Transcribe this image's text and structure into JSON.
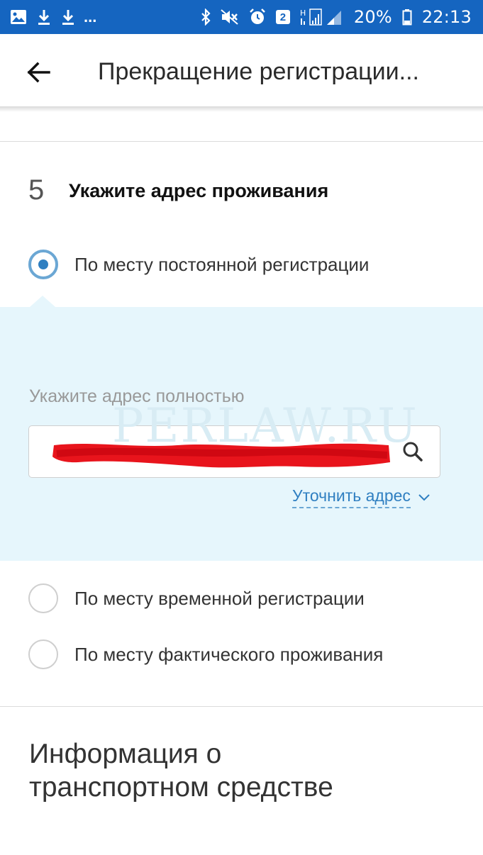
{
  "status_bar": {
    "left_icons": [
      "image-icon",
      "download-icon",
      "download-icon"
    ],
    "more": "...",
    "right_icons": [
      "bluetooth-icon",
      "mute-icon",
      "alarm-icon"
    ],
    "badge": "2",
    "network_type": "H",
    "battery": "20%",
    "time": "22:13"
  },
  "app_bar": {
    "back_icon": "arrow-left-icon",
    "title": "Прекращение регистрации..."
  },
  "step": {
    "number": "5",
    "title": "Укажите адрес проживания"
  },
  "options": [
    {
      "label": "По месту постоянной регистрации",
      "checked": true
    },
    {
      "label": "По месту временной регистрации",
      "checked": false
    },
    {
      "label": "По месту фактического проживания",
      "checked": false
    }
  ],
  "address": {
    "label": "Укажите адрес полностью",
    "watermark": "PERLAW.RU",
    "search_icon": "search-icon",
    "refine_link": "Уточнить адрес",
    "redaction_color": "#e8141c"
  },
  "next_section": {
    "title_line1": "Информация о",
    "title_line2": "транспортном средстве"
  },
  "colors": {
    "status_bar": "#1565c0",
    "accent": "#2f7fc1",
    "panel": "#e6f6fc"
  }
}
